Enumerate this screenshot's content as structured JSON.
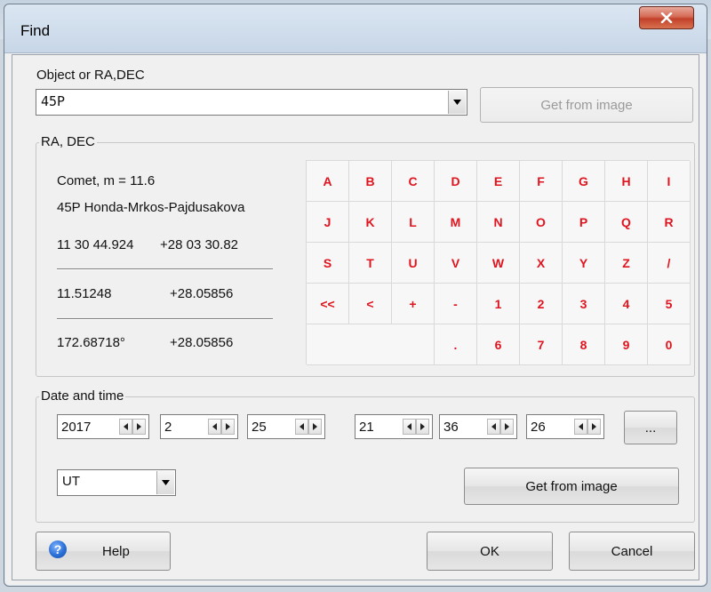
{
  "window": {
    "title": "Find",
    "close_glyph": "X"
  },
  "object": {
    "label": "Object or RA,DEC",
    "value": "45P",
    "get_from_image_label": "Get from image"
  },
  "radec": {
    "group_title": "RA, DEC",
    "type_line": "Comet,  m = 11.6",
    "name_line": "45P Honda-Mrkos-Pajdusakova",
    "sexagesimal_ra": "11 30 44.924",
    "sexagesimal_dec": "+28 03 30.82",
    "hours_ra": "11.51248",
    "hours_dec": "+28.05856",
    "degrees_ra": "172.68718°",
    "degrees_dec": "+28.05856"
  },
  "keypad": {
    "rows": [
      [
        "A",
        "B",
        "C",
        "D",
        "E",
        "F",
        "G",
        "H",
        "I"
      ],
      [
        "J",
        "K",
        "L",
        "M",
        "N",
        "O",
        "P",
        "Q",
        "R"
      ],
      [
        "S",
        "T",
        "U",
        "V",
        "W",
        "X",
        "Y",
        "Z",
        "/"
      ],
      [
        "<<",
        "<",
        "+",
        "-",
        "1",
        "2",
        "3",
        "4",
        "5"
      ],
      [
        "",
        "",
        "",
        " .",
        "6",
        "7",
        "8",
        "9",
        "0"
      ]
    ],
    "text_color": "#e0141e"
  },
  "datetime": {
    "group_title": "Date and time",
    "year": "2017",
    "month": "2",
    "day": "25",
    "hour": "21",
    "minute": "36",
    "second": "26",
    "ellipsis_label": "...",
    "timezone": "UT",
    "get_from_image_label": "Get from image"
  },
  "footer": {
    "help_label": "Help",
    "ok_label": "OK",
    "cancel_label": "Cancel"
  },
  "icons": {
    "close": "close-icon",
    "dropdown": "chevron-down-icon",
    "help": "help-icon",
    "spin_left": "arrow-left-icon",
    "spin_right": "arrow-right-icon"
  }
}
